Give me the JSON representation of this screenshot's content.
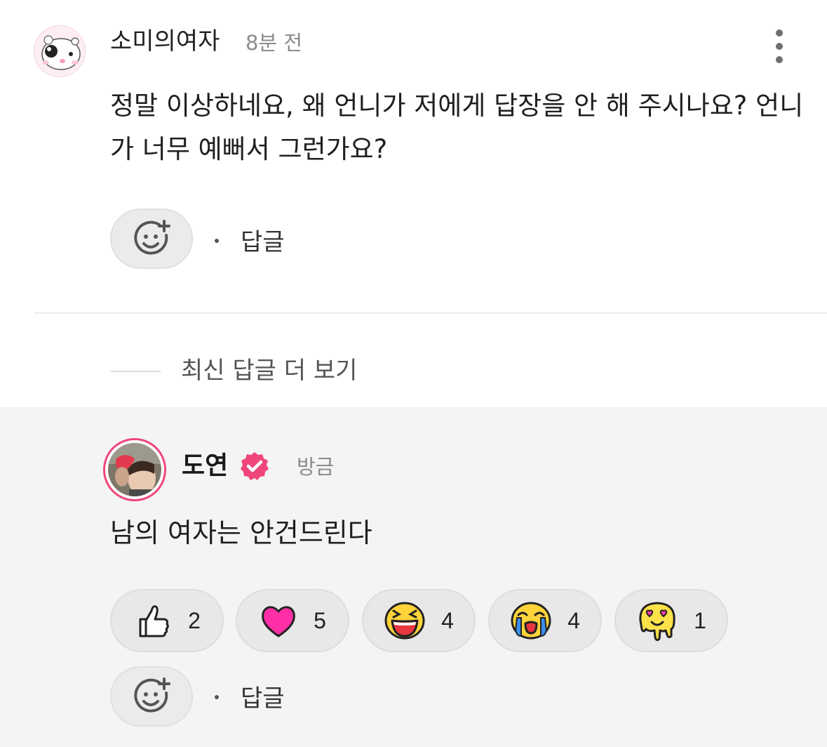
{
  "comment": {
    "username": "소미의여자",
    "time": "8분 전",
    "text": "정말 이상하네요, 왜 언니가 저에게 답장을 안 해 주시나요? 언니가 너무 예뻐서 그런가요?",
    "reply_label": "답글",
    "more_icon": "more-vertical-icon",
    "react_icon": "add-reaction-icon"
  },
  "more_replies_label": "최신 답글 더 보기",
  "reply": {
    "username": "도연",
    "verified_icon": "verified-badge-icon",
    "time": "방금",
    "text": "남의 여자는 안건드린다",
    "reply_label": "답글",
    "reactions": [
      {
        "icon": "thumbs-up-icon",
        "count": "2"
      },
      {
        "icon": "heart-icon",
        "count": "5",
        "color": "#ff2fa8"
      },
      {
        "icon": "laughing-face-icon",
        "count": "4"
      },
      {
        "icon": "crying-face-icon",
        "count": "4"
      },
      {
        "icon": "melting-heart-eyes-icon",
        "count": "1"
      }
    ]
  },
  "colors": {
    "accent_pink": "#f0467b",
    "reply_bg": "#f4f4f4"
  }
}
